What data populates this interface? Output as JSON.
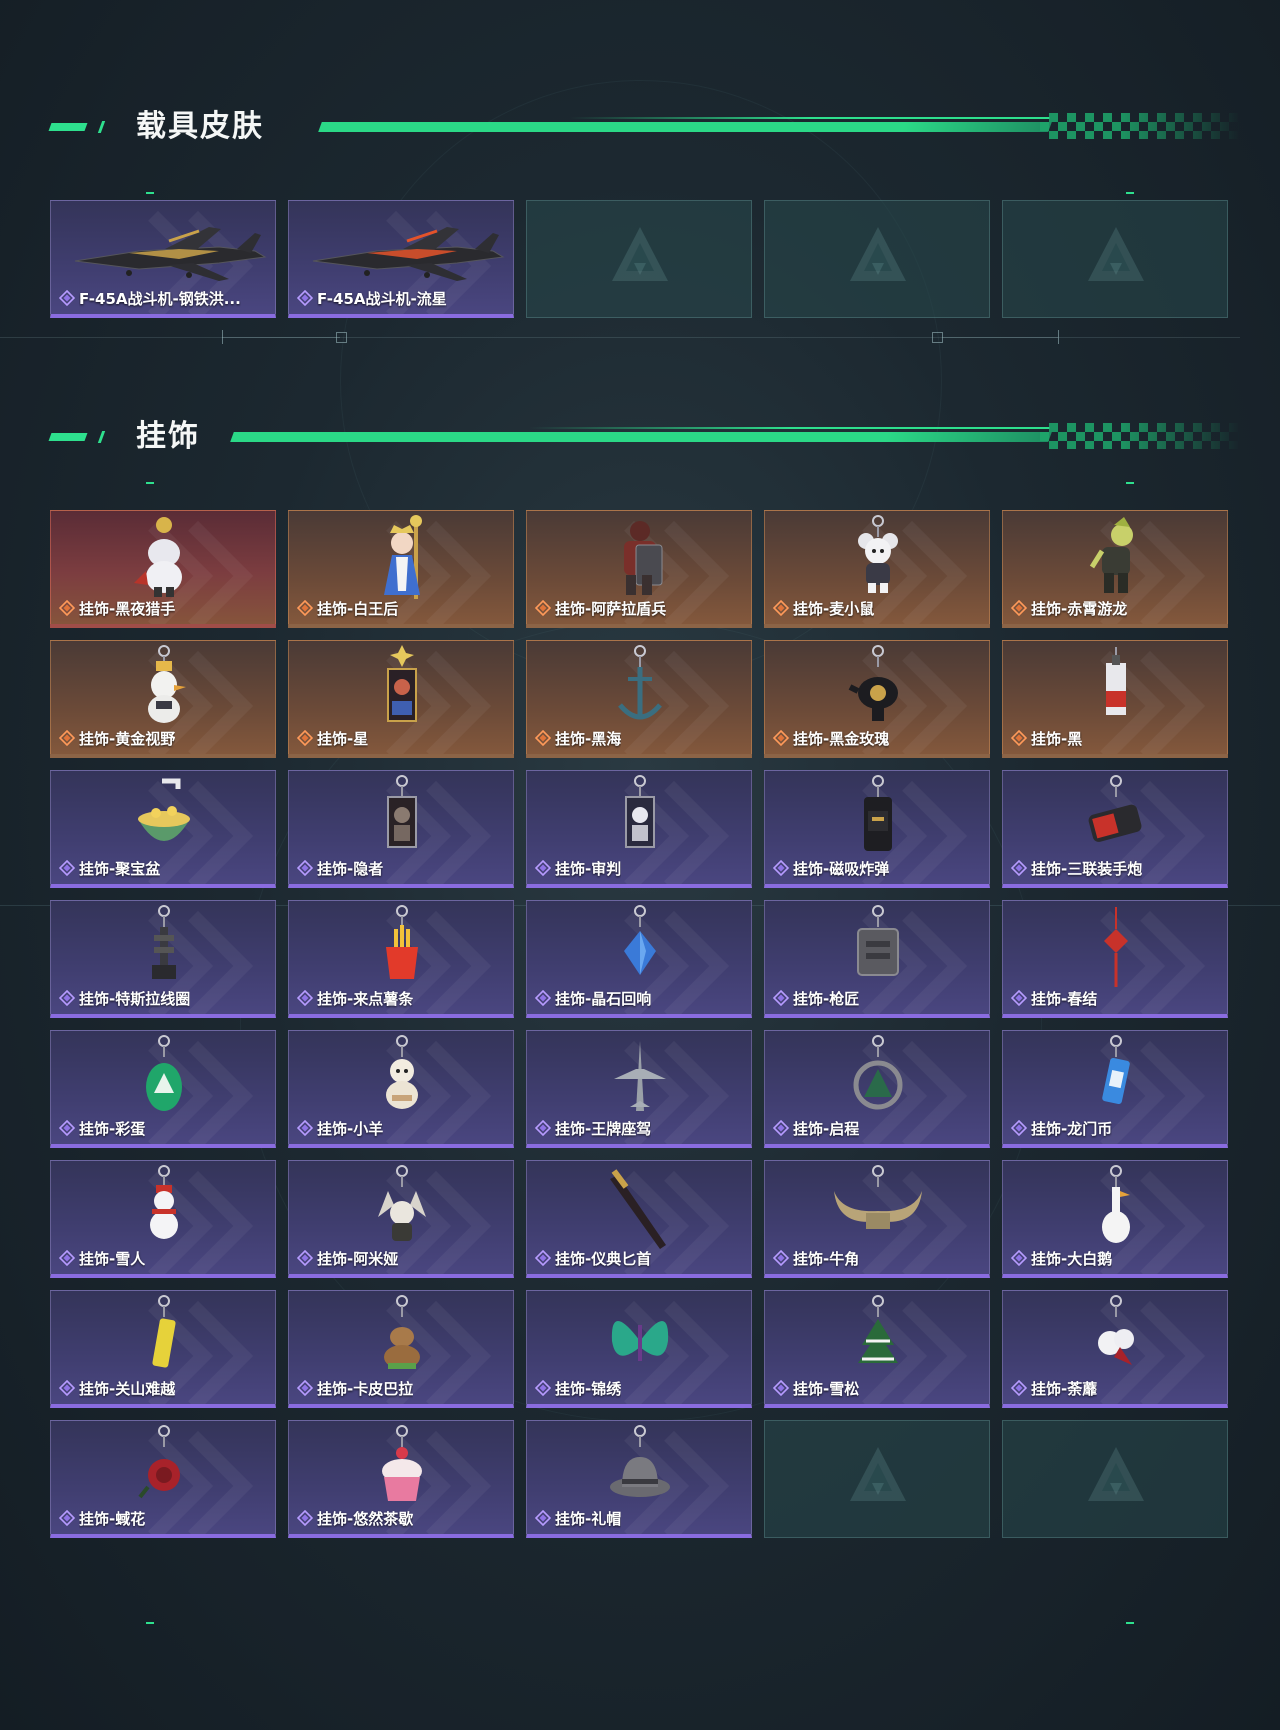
{
  "sections": {
    "vehicle": {
      "title": "载具皮肤",
      "items": [
        {
          "label": "F-45A战斗机-钢铁洪...",
          "rarity": "purple",
          "art": "jet-black-gold",
          "empty": false
        },
        {
          "label": "F-45A战斗机-流星",
          "rarity": "purple",
          "art": "jet-black-red",
          "empty": false
        },
        {
          "label": "",
          "rarity": "empty",
          "art": "",
          "empty": true
        },
        {
          "label": "",
          "rarity": "empty",
          "art": "",
          "empty": true
        },
        {
          "label": "",
          "rarity": "empty",
          "art": "",
          "empty": true
        }
      ]
    },
    "charms": {
      "title": "挂饰",
      "items": [
        {
          "label": "挂饰-黑夜猎手",
          "rarity": "red",
          "art": "white-wolf-figure"
        },
        {
          "label": "挂饰-白王后",
          "rarity": "orange",
          "art": "queen-figure"
        },
        {
          "label": "挂饰-阿萨拉盾兵",
          "rarity": "orange",
          "art": "shield-soldier-figure"
        },
        {
          "label": "挂饰-麦小鼠",
          "rarity": "orange",
          "art": "mouse-figure"
        },
        {
          "label": "挂饰-赤霄游龙",
          "rarity": "orange",
          "art": "dragon-figure"
        },
        {
          "label": "挂饰-黄金视野",
          "rarity": "orange",
          "art": "duck-figure"
        },
        {
          "label": "挂饰-星",
          "rarity": "orange",
          "art": "tarot-card"
        },
        {
          "label": "挂饰-黑海",
          "rarity": "orange",
          "art": "anchor"
        },
        {
          "label": "挂饰-黑金玫瑰",
          "rarity": "orange",
          "art": "black-rose-pot"
        },
        {
          "label": "挂饰-黑",
          "rarity": "orange",
          "art": "red-tag"
        },
        {
          "label": "挂饰-聚宝盆",
          "rarity": "purple",
          "art": "treasure-bowl"
        },
        {
          "label": "挂饰-隐者",
          "rarity": "purple",
          "art": "hermit-card"
        },
        {
          "label": "挂饰-审判",
          "rarity": "purple",
          "art": "judgement-card"
        },
        {
          "label": "挂饰-磁吸炸弹",
          "rarity": "purple",
          "art": "magnet-bomb"
        },
        {
          "label": "挂饰-三联装手炮",
          "rarity": "purple",
          "art": "hand-cannon"
        },
        {
          "label": "挂饰-特斯拉线圈",
          "rarity": "purple",
          "art": "tesla-coil"
        },
        {
          "label": "挂饰-来点薯条",
          "rarity": "purple",
          "art": "fries"
        },
        {
          "label": "挂饰-晶石回响",
          "rarity": "purple",
          "art": "crystal"
        },
        {
          "label": "挂饰-枪匠",
          "rarity": "purple",
          "art": "gunsmith-plate"
        },
        {
          "label": "挂饰-春结",
          "rarity": "purple",
          "art": "chinese-knot"
        },
        {
          "label": "挂饰-彩蛋",
          "rarity": "purple",
          "art": "green-egg"
        },
        {
          "label": "挂饰-小羊",
          "rarity": "purple",
          "art": "lamb"
        },
        {
          "label": "挂饰-王牌座驾",
          "rarity": "purple",
          "art": "plane"
        },
        {
          "label": "挂饰-启程",
          "rarity": "purple",
          "art": "start-badge"
        },
        {
          "label": "挂饰-龙门币",
          "rarity": "purple",
          "art": "blue-can"
        },
        {
          "label": "挂饰-雪人",
          "rarity": "purple",
          "art": "snowman"
        },
        {
          "label": "挂饰-阿米娅",
          "rarity": "purple",
          "art": "bunny"
        },
        {
          "label": "挂饰-仪典匕首",
          "rarity": "purple",
          "art": "dagger"
        },
        {
          "label": "挂饰-牛角",
          "rarity": "purple",
          "art": "horns"
        },
        {
          "label": "挂饰-大白鹅",
          "rarity": "purple",
          "art": "goose"
        },
        {
          "label": "挂饰-关山难越",
          "rarity": "purple",
          "art": "yellow-can"
        },
        {
          "label": "挂饰-卡皮巴拉",
          "rarity": "purple",
          "art": "capybara"
        },
        {
          "label": "挂饰-锦绣",
          "rarity": "purple",
          "art": "butterfly"
        },
        {
          "label": "挂饰-雪松",
          "rarity": "purple",
          "art": "snow-pine"
        },
        {
          "label": "挂饰-荼蘼",
          "rarity": "purple",
          "art": "white-flower"
        },
        {
          "label": "挂饰-蜮花",
          "rarity": "purple",
          "art": "red-flower"
        },
        {
          "label": "挂饰-悠然茶歇",
          "rarity": "purple",
          "art": "cupcake"
        },
        {
          "label": "挂饰-礼帽",
          "rarity": "purple",
          "art": "fedora"
        },
        {
          "label": "",
          "rarity": "empty",
          "art": "",
          "empty": true
        },
        {
          "label": "",
          "rarity": "empty",
          "art": "",
          "empty": true
        }
      ]
    }
  },
  "colors": {
    "accent_green": "#2ee08e",
    "rarity_purple": "#8a6ce0",
    "rarity_orange": "#e68a3a",
    "rarity_red": "#e66a3a"
  }
}
